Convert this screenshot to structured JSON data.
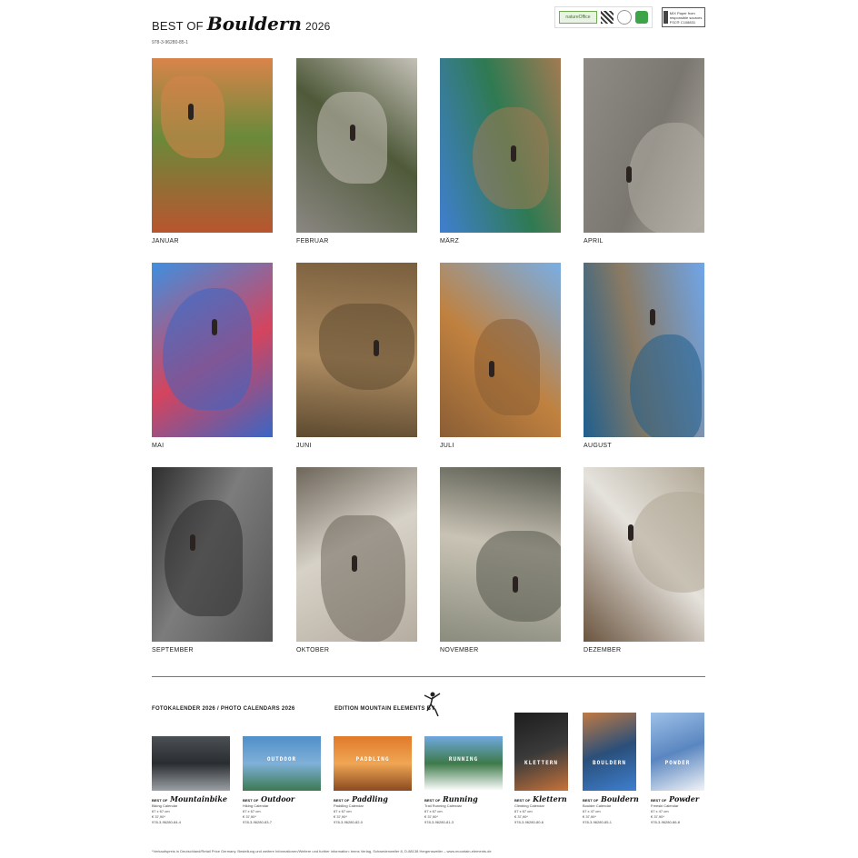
{
  "header": {
    "best_of": "BEST OF",
    "title": "Bouldern",
    "year": "2026",
    "isbn": "978-3-96280-85-1",
    "logos": {
      "natureoffice": "natureOffice",
      "fsc": "MIX Paper from responsible sources FSC® C108831"
    }
  },
  "months": [
    {
      "label": "JANUAR",
      "colors": [
        "#b8552f",
        "#6a8a3a",
        "#d9844a"
      ]
    },
    {
      "label": "FEBRUAR",
      "colors": [
        "#8a8782",
        "#4f5a3a",
        "#c4c0b7"
      ]
    },
    {
      "label": "MÄRZ",
      "colors": [
        "#3f7fd0",
        "#2f7a52",
        "#a27a52"
      ]
    },
    {
      "label": "APRIL",
      "colors": [
        "#8f8c85",
        "#7a7770",
        "#b3aea5"
      ]
    },
    {
      "label": "MAI",
      "colors": [
        "#3f8fe0",
        "#d4445e",
        "#3a66c4"
      ]
    },
    {
      "label": "JUNI",
      "colors": [
        "#7a5f3e",
        "#b08e63",
        "#5e4a30"
      ]
    },
    {
      "label": "JULI",
      "colors": [
        "#79aee5",
        "#c0813f",
        "#8a5e35"
      ]
    },
    {
      "label": "AUGUST",
      "colors": [
        "#6fa5e8",
        "#8a7a63",
        "#1f5f8e"
      ]
    },
    {
      "label": "SEPTEMBER",
      "colors": [
        "#555555",
        "#7c7c7c",
        "#2e2e2e"
      ]
    },
    {
      "label": "OKTOBER",
      "colors": [
        "#b6ada0",
        "#d7d2c8",
        "#6e665b"
      ]
    },
    {
      "label": "NOVEMBER",
      "colors": [
        "#8a8c7e",
        "#c9c3b5",
        "#56584d"
      ]
    },
    {
      "label": "DEZEMBER",
      "colors": [
        "#6b5540",
        "#e5e2dc",
        "#b0a795"
      ]
    }
  ],
  "sections": {
    "photo_calendars": "FOTOKALENDER 2026 / PHOTO CALENDARS 2026",
    "edition": "EDITION MOUNTAIN ELEMENTS BY"
  },
  "products": [
    {
      "best_of": "BEST OF",
      "name": "Mountainbike",
      "sub": "Biking Calendar",
      "size": "67 x 67 cm",
      "price": "€ 37,90*",
      "isbn": "978-3-96280-84-4",
      "img_label": "",
      "colors": [
        "#4b5055",
        "#9aa0a6",
        "#2a2d30"
      ]
    },
    {
      "best_of": "BEST OF",
      "name": "Outdoor",
      "sub": "Hiking Calendar",
      "size": "67 x 67 cm",
      "price": "€ 37,90*",
      "isbn": "978-3-96280-83-7",
      "img_label": "OUTDOOR",
      "colors": [
        "#4f8fc9",
        "#3b7a52",
        "#7fb0d8"
      ]
    },
    {
      "best_of": "BEST OF",
      "name": "Paddling",
      "sub": "Paddling Calendar",
      "size": "67 x 67 cm",
      "price": "€ 37,90*",
      "isbn": "978-3-96280-82-0",
      "img_label": "PADDLING",
      "colors": [
        "#e07a2a",
        "#8a4a20",
        "#f0a654"
      ]
    },
    {
      "best_of": "BEST OF",
      "name": "Running",
      "sub": "Trail Running Calendar",
      "size": "67 x 67 cm",
      "price": "€ 37,90*",
      "isbn": "978-3-96280-81-3",
      "img_label": "RUNNING",
      "colors": [
        "#6fa8e0",
        "#ffffff",
        "#3e7a4a"
      ]
    },
    {
      "best_of": "BEST OF",
      "name": "Klettern",
      "sub": "Climbing Calendar",
      "size": "67 x 67 cm",
      "price": "€ 37,90*",
      "isbn": "978-3-96280-80-6",
      "img_label": "KLETTERN",
      "colors": [
        "#1d1d1d",
        "#c8733a",
        "#3a3a3a"
      ]
    },
    {
      "best_of": "BEST OF",
      "name": "Bouldern",
      "sub": "Boulder Calendar",
      "size": "67 x 47 cm",
      "price": "€ 37,90*",
      "isbn": "978-3-96280-85-1",
      "img_label": "BOULDERN",
      "colors": [
        "#c07a42",
        "#3e7fd0",
        "#2a4f7a"
      ]
    },
    {
      "best_of": "BEST OF",
      "name": "Powder",
      "sub": "Freeski Calendar",
      "size": "67 x 47 cm",
      "price": "€ 37,90*",
      "isbn": "978-3-96280-86-8",
      "img_label": "POWDER",
      "colors": [
        "#9dc0e8",
        "#f2f4f7",
        "#5a86c0"
      ]
    }
  ],
  "footer": "*Verkaufspreis in Deutschland/Retail Price Germany. Bestellung und weitere Informationen/Weitere und further information: tmms Verlag, Schwedenweiler 8, D-88138 Hergensweiler – www.mountain-elements.de"
}
